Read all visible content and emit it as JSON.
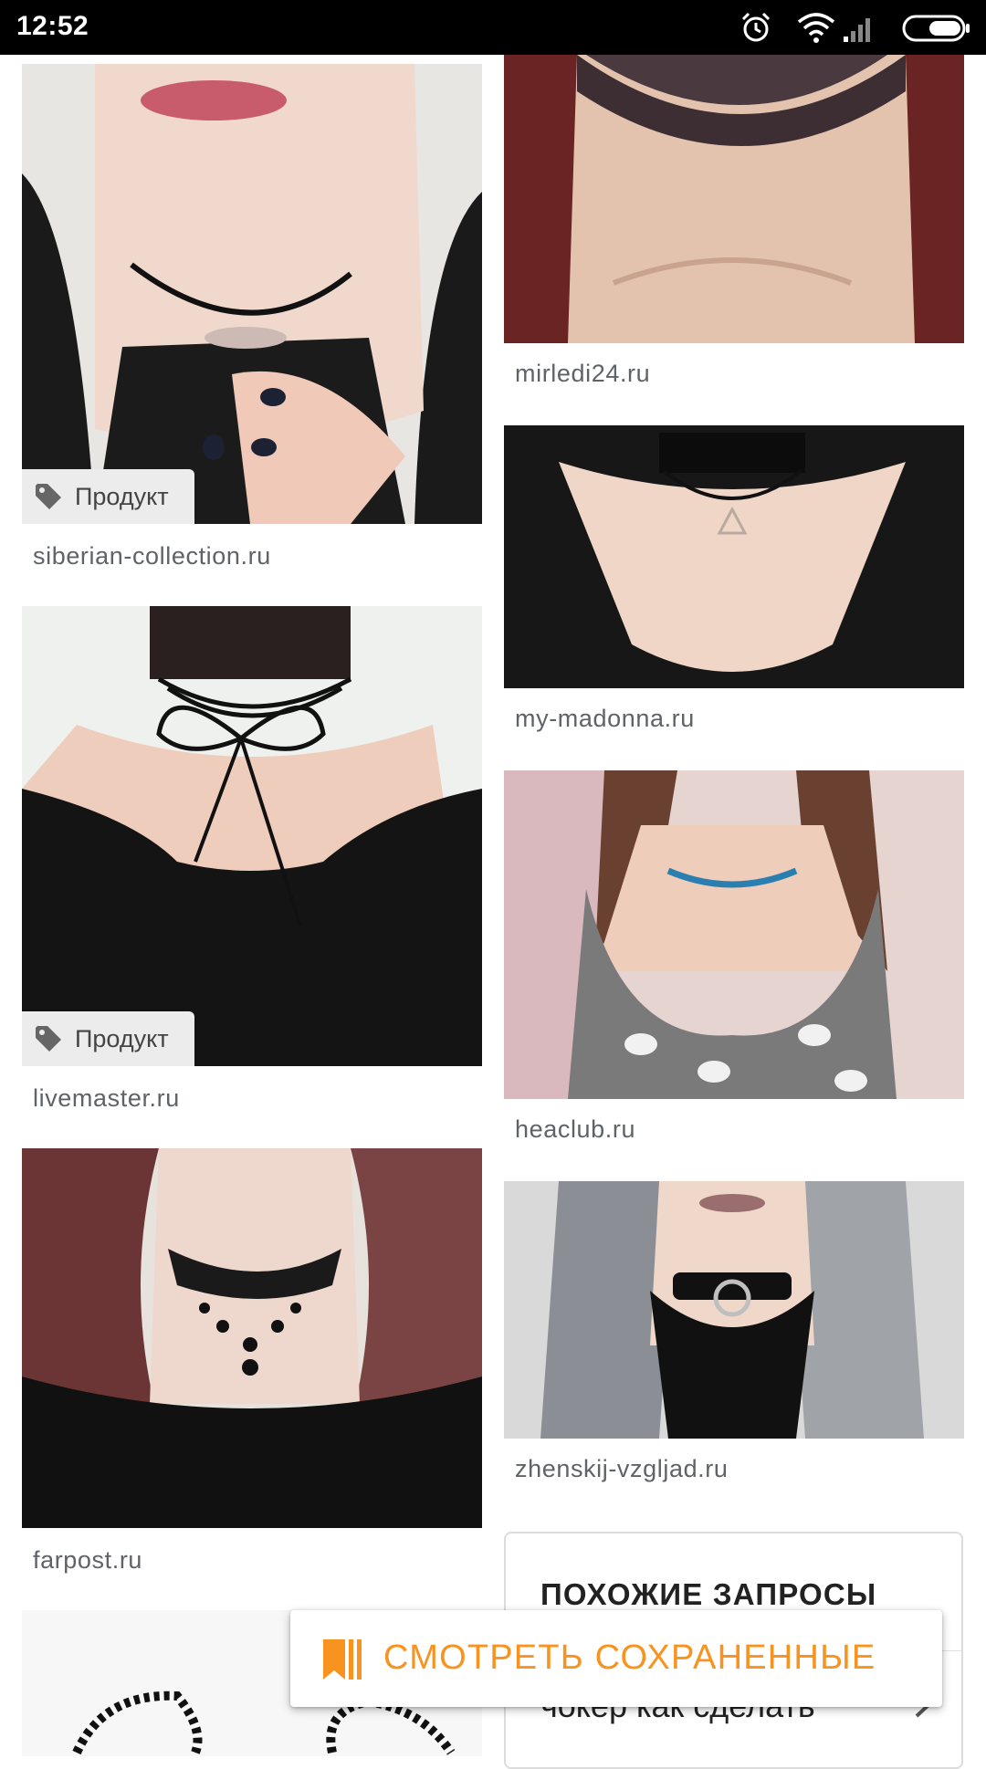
{
  "status_bar": {
    "time": "12:52",
    "icons": [
      "alarm-icon",
      "wifi-icon",
      "signal-icon",
      "battery-icon"
    ]
  },
  "results": [
    {
      "source": "siberian-collection.ru",
      "badge": "Продукт"
    },
    {
      "source": "mirledi24.ru"
    },
    {
      "source": "my-madonna.ru"
    },
    {
      "source": "livemaster.ru",
      "badge": "Продукт"
    },
    {
      "source": "heaclub.ru"
    },
    {
      "source": "zhenskij-vzgljad.ru"
    },
    {
      "source": "farpost.ru"
    }
  ],
  "related": {
    "title": "ПОХОЖИЕ ЗАПРОСЫ",
    "first_item": "чокер как сделать"
  },
  "saved_button": {
    "label": "СМОТРЕТЬ СОХРАНЕННЫЕ",
    "icon": "bookmark-icon",
    "color": "#f7931e"
  }
}
